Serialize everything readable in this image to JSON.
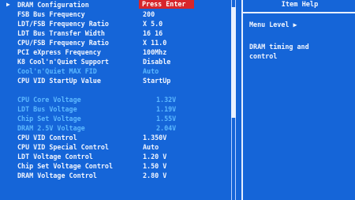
{
  "menu_items": [
    {
      "label": "DRAM Configuration",
      "value": "Press Enter",
      "selected": true,
      "arrow": "▶",
      "dim": false
    },
    {
      "label": "FSB Bus Frequency",
      "value": "200",
      "dim": false
    },
    {
      "label": "LDT/FSB Frequency Ratio",
      "value": "X 5.0",
      "dim": false
    },
    {
      "label": "LDT Bus Transfer Width",
      "value": "16 16",
      "dim": false
    },
    {
      "label": "CPU/FSB Frequency Ratio",
      "value": "X 11.0",
      "dim": false
    },
    {
      "label": "PCI eXpress Frequency",
      "value": "100Mhz",
      "dim": false
    },
    {
      "label": "K8 Cool'n'Quiet Support",
      "value": "Disable",
      "dim": false
    },
    {
      "label": "Cool'n'Quiet MAX FID",
      "value": "Auto",
      "dim": true
    },
    {
      "label": "CPU VID StartUp Value",
      "value": "StartUp",
      "dim": false
    },
    {
      "label": "",
      "value": "",
      "dim": false
    },
    {
      "label": "CPU Core  Voltage",
      "value": "1.32V",
      "dim": true
    },
    {
      "label": "LDT Bus  Voltage",
      "value": "1.19V",
      "dim": true
    },
    {
      "label": "Chip Set  Voltage",
      "value": "1.55V",
      "dim": true
    },
    {
      "label": "DRAM 2.5V Voltage",
      "value": "2.04V",
      "dim": true
    },
    {
      "label": "CPU VID Control",
      "value": "1.350V",
      "dim": false
    },
    {
      "label": "CPU VID Special Control",
      "value": "Auto",
      "dim": false
    },
    {
      "label": "LDT Voltage Control",
      "value": "1.20 V",
      "dim": false
    },
    {
      "label": "Chip Set Voltage Control",
      "value": "1.50 V",
      "dim": false
    },
    {
      "label": "DRAM Voltage Control",
      "value": "2.80 V",
      "dim": false
    }
  ],
  "help": {
    "title": "Item Help",
    "menu_level": "Menu Level  ▶",
    "description_line1": "DRAM timing and",
    "description_line2": "control"
  }
}
